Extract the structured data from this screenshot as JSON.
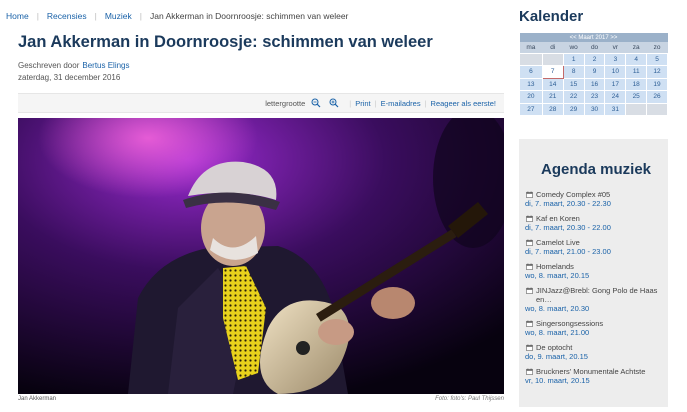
{
  "breadcrumb": {
    "items": [
      "Home",
      "Recensies",
      "Muziek"
    ],
    "current": "Jan Akkerman in Doornroosje: schimmen van weleer"
  },
  "article": {
    "title": "Jan Akkerman in Doornroosje: schimmen van weleer",
    "written_by_label": "Geschreven door",
    "author": "Bertus Elings",
    "date": "zaterdag, 31 december 2016",
    "photo_caption": "Jan Akkerman",
    "photo_credit": "Foto: foto's: Paul Thijssen"
  },
  "toolbar": {
    "font_size_label": "lettergrootte",
    "print_label": "Print",
    "email_label": "E-mailadres",
    "comment_label": "Reageer als eerste!"
  },
  "sidebar": {
    "calendar_title": "Kalender",
    "calendar": {
      "month_label": "<< Maart 2017 >>",
      "weekdays": [
        "ma",
        "di",
        "wo",
        "do",
        "vr",
        "za",
        "zo"
      ],
      "weeks": [
        [
          "",
          "",
          "1",
          "2",
          "3",
          "4",
          "5"
        ],
        [
          "6",
          "7",
          "8",
          "9",
          "10",
          "11",
          "12"
        ],
        [
          "13",
          "14",
          "15",
          "16",
          "17",
          "18",
          "19"
        ],
        [
          "20",
          "21",
          "22",
          "23",
          "24",
          "25",
          "26"
        ],
        [
          "27",
          "28",
          "29",
          "30",
          "31",
          "",
          ""
        ]
      ],
      "today": "7"
    },
    "agenda_title": "Agenda muziek",
    "agenda": [
      {
        "title": "Comedy Complex #05",
        "date": "di, 7. maart, 20.30 - 22.30"
      },
      {
        "title": "Kaf en Koren",
        "date": "di, 7. maart, 20.30 - 22.00"
      },
      {
        "title": "Camelot Live",
        "date": "di, 7. maart, 21.00 - 23.00"
      },
      {
        "title": "Homelands",
        "date": "wo, 8. maart, 20.15"
      },
      {
        "title": "JINJazz@Brebl: Gong Polo de Haas en…",
        "date": "wo, 8. maart, 20.30"
      },
      {
        "title": "Singersongsessions",
        "date": "wo, 8. maart, 21.00"
      },
      {
        "title": "De optocht",
        "date": "do, 9. maart, 20.15"
      },
      {
        "title": "Bruckners' Monumentale Achtste",
        "date": "vr, 10. maart, 20.15"
      }
    ]
  }
}
